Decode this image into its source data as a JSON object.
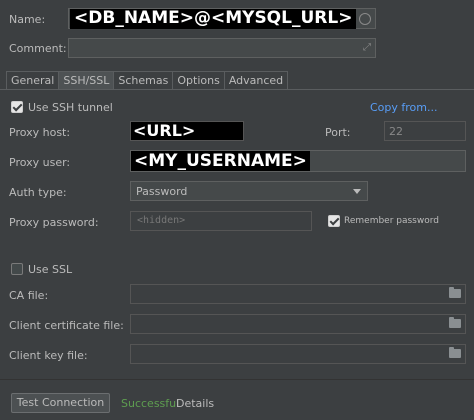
{
  "general": {
    "name_label": "Name:",
    "name_value": "<DB_NAME>@<MYSQL_URL>",
    "comment_label": "Comment:",
    "comment_value": ""
  },
  "tabs": [
    {
      "label": "General",
      "active": false
    },
    {
      "label": "SSH/SSL",
      "active": true
    },
    {
      "label": "Schemas",
      "active": false
    },
    {
      "label": "Options",
      "active": false
    },
    {
      "label": "Advanced",
      "active": false
    }
  ],
  "ssh": {
    "use_tunnel_label": "Use SSH tunnel",
    "use_tunnel_checked": true,
    "copy_from_label": "Copy from...",
    "proxy_host_label": "Proxy host:",
    "proxy_host_value": "<URL>",
    "port_label": "Port:",
    "port_value": "22",
    "proxy_user_label": "Proxy user:",
    "proxy_user_value": "<MY_USERNAME>",
    "auth_type_label": "Auth type:",
    "auth_type_value": "Password",
    "proxy_password_label": "Proxy password:",
    "proxy_password_placeholder": "<hidden>",
    "remember_password_label": "Remember password",
    "remember_password_checked": true
  },
  "ssl": {
    "use_ssl_label": "Use SSL",
    "use_ssl_checked": false,
    "ca_file_label": "CA file:",
    "client_cert_label": "Client certificate file:",
    "client_key_label": "Client key file:"
  },
  "footer": {
    "test_button_label": "Test Connection",
    "status_text": "Successful",
    "details_label": "Details"
  },
  "colors": {
    "background": "#3c3f41",
    "link": "#589df6",
    "success": "#5e9e50"
  }
}
